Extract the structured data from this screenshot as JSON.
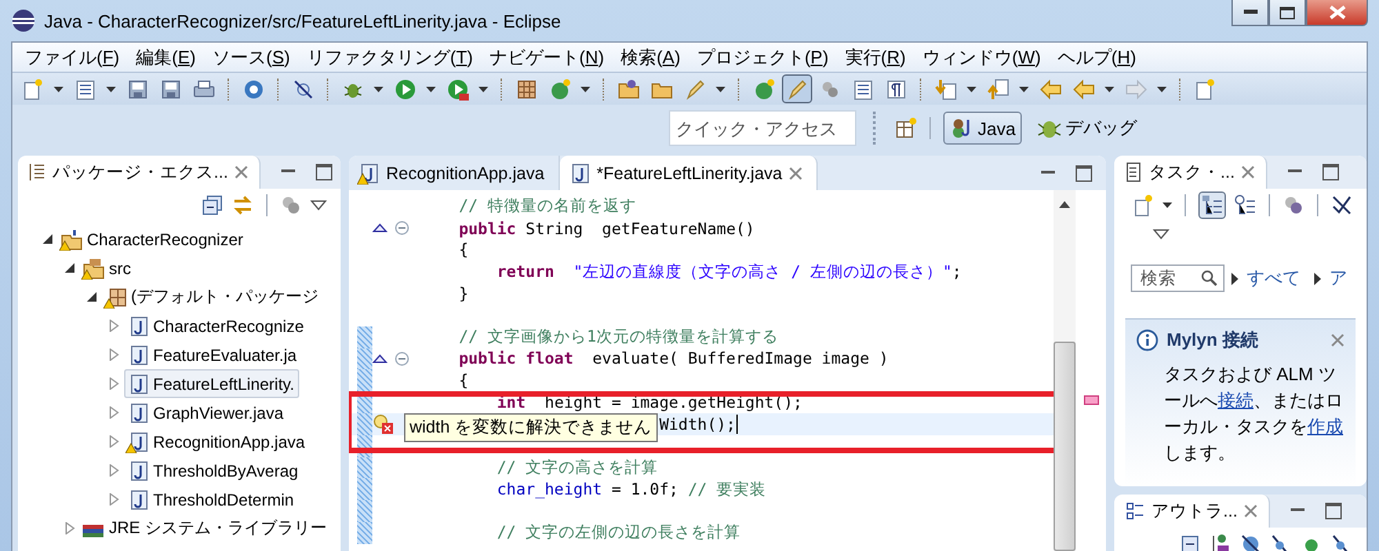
{
  "window": {
    "title": "Java - CharacterRecognizer/src/FeatureLeftLinerity.java - Eclipse"
  },
  "menu": [
    {
      "pre": "ファイル(",
      "key": "F",
      "post": ")"
    },
    {
      "pre": "編集(",
      "key": "E",
      "post": ")"
    },
    {
      "pre": "ソース(",
      "key": "S",
      "post": ")"
    },
    {
      "pre": "リファクタリング(",
      "key": "T",
      "post": ")"
    },
    {
      "pre": "ナビゲート(",
      "key": "N",
      "post": ")"
    },
    {
      "pre": "検索(",
      "key": "A",
      "post": ")"
    },
    {
      "pre": "プロジェクト(",
      "key": "P",
      "post": ")"
    },
    {
      "pre": "実行(",
      "key": "R",
      "post": ")"
    },
    {
      "pre": "ウィンドウ(",
      "key": "W",
      "post": ")"
    },
    {
      "pre": "ヘルプ(",
      "key": "H",
      "post": ")"
    }
  ],
  "quick_access": {
    "placeholder": "クイック・アクセス"
  },
  "perspectives": [
    {
      "label": "Java",
      "kind": "java",
      "selected": true
    },
    {
      "label": "デバッグ",
      "kind": "debug",
      "selected": false
    }
  ],
  "package_explorer": {
    "title": "パッケージ・エクス...",
    "tree": [
      {
        "label": "CharacterRecognizer",
        "kind": "project",
        "expanded": true,
        "selected": false,
        "warning": true,
        "children": [
          {
            "label": "src",
            "kind": "source-folder",
            "expanded": true,
            "selected": false,
            "warning": true,
            "children": [
              {
                "label": "(デフォルト・パッケージ",
                "kind": "package",
                "expanded": true,
                "selected": false,
                "warning": true,
                "children": [
                  {
                    "label": "CharacterRecognize",
                    "kind": "java-file",
                    "expanded": false,
                    "selected": false,
                    "warning": false
                  },
                  {
                    "label": "FeatureEvaluater.ja",
                    "kind": "java-file",
                    "expanded": false,
                    "selected": false,
                    "warning": false
                  },
                  {
                    "label": "FeatureLeftLinerity.",
                    "kind": "java-file",
                    "expanded": false,
                    "selected": true,
                    "warning": false
                  },
                  {
                    "label": "GraphViewer.java",
                    "kind": "java-file",
                    "expanded": false,
                    "selected": false,
                    "warning": false
                  },
                  {
                    "label": "RecognitionApp.java",
                    "kind": "java-file",
                    "expanded": false,
                    "selected": false,
                    "warning": true
                  },
                  {
                    "label": "ThresholdByAverag",
                    "kind": "java-file",
                    "expanded": false,
                    "selected": false,
                    "warning": false
                  },
                  {
                    "label": "ThresholdDetermin",
                    "kind": "java-file",
                    "expanded": false,
                    "selected": false,
                    "warning": false
                  }
                ]
              }
            ]
          },
          {
            "label": "JRE システム・ライブラリー",
            "kind": "library",
            "expanded": false,
            "selected": false,
            "warning": false
          }
        ]
      }
    ]
  },
  "editor": {
    "tabs": [
      {
        "label": "RecognitionApp.java",
        "selected": false,
        "warning": true
      },
      {
        "label": "*FeatureLeftLinerity.java",
        "selected": true,
        "warning": false
      }
    ],
    "lines": [
      {
        "override": false,
        "error": false,
        "fold": false,
        "changed": false,
        "current": false,
        "tokens": [
          {
            "kind": "comment",
            "text": "    // 特徴量の名前を返す"
          }
        ]
      },
      {
        "override": true,
        "error": false,
        "fold": true,
        "changed": false,
        "current": false,
        "tokens": [
          {
            "kind": "keyword",
            "text": "    public"
          },
          {
            "kind": "plain",
            "text": " String  getFeatureName()"
          }
        ]
      },
      {
        "override": false,
        "error": false,
        "fold": false,
        "changed": false,
        "current": false,
        "tokens": [
          {
            "kind": "plain",
            "text": "    {"
          }
        ]
      },
      {
        "override": false,
        "error": false,
        "fold": false,
        "changed": false,
        "current": false,
        "tokens": [
          {
            "kind": "keyword",
            "text": "        return"
          },
          {
            "kind": "string",
            "text": "  \"左辺の直線度（文字の高さ / 左側の辺の長さ）\""
          },
          {
            "kind": "plain",
            "text": ";"
          }
        ]
      },
      {
        "override": false,
        "error": false,
        "fold": false,
        "changed": false,
        "current": false,
        "tokens": [
          {
            "kind": "plain",
            "text": "    }"
          }
        ]
      },
      {
        "override": false,
        "error": false,
        "fold": false,
        "changed": false,
        "current": false
      },
      {
        "override": false,
        "error": false,
        "fold": false,
        "changed": true,
        "current": false,
        "tokens": [
          {
            "kind": "comment",
            "text": "    // 文字画像から1次元の特徴量を計算する"
          }
        ]
      },
      {
        "override": true,
        "error": false,
        "fold": true,
        "changed": true,
        "current": false,
        "tokens": [
          {
            "kind": "keyword",
            "text": "    public float"
          },
          {
            "kind": "plain",
            "text": "  evaluate( BufferedImage image )"
          }
        ]
      },
      {
        "override": false,
        "error": false,
        "fold": false,
        "changed": true,
        "current": false,
        "tokens": [
          {
            "kind": "plain",
            "text": "    {"
          }
        ]
      },
      {
        "override": false,
        "error": false,
        "fold": false,
        "changed": true,
        "current": false,
        "tokens": [
          {
            "kind": "keyword",
            "text": "        int"
          },
          {
            "kind": "plain",
            "text": "  height = image.getHeight();"
          }
        ]
      },
      {
        "override": false,
        "error": true,
        "fold": false,
        "changed": true,
        "current": true,
        "tokens": [
          {
            "kind": "plain",
            "text": "                         Width();"
          }
        ]
      },
      {
        "override": false,
        "error": false,
        "fold": false,
        "changed": true,
        "current": false
      },
      {
        "override": false,
        "error": false,
        "fold": false,
        "changed": true,
        "current": false,
        "tokens": [
          {
            "kind": "comment",
            "text": "        // 文字の高さを計算"
          }
        ]
      },
      {
        "override": false,
        "error": false,
        "fold": false,
        "changed": true,
        "current": false,
        "tokens": [
          {
            "kind": "field",
            "text": "        char_height"
          },
          {
            "kind": "plain",
            "text": " = 1.0f; "
          },
          {
            "kind": "comment",
            "text": "// 要実装"
          }
        ]
      },
      {
        "override": false,
        "error": false,
        "fold": false,
        "changed": true,
        "current": false
      },
      {
        "override": false,
        "error": false,
        "fold": false,
        "changed": true,
        "current": false,
        "tokens": [
          {
            "kind": "comment",
            "text": "        // 文字の左側の辺の長さを計算"
          }
        ]
      }
    ],
    "tooltip": "width を変数に解決できません"
  },
  "task_list": {
    "title": "タスク・...",
    "search": {
      "placeholder": "検索"
    },
    "filters": [
      "すべて",
      "ア"
    ]
  },
  "mylyn": {
    "title": "Mylyn 接続",
    "before": "タスクおよび ALM ツールへ",
    "link1": "接続",
    "middle": "、またはローカル・タスクを",
    "link2": "作成",
    "after": "します。"
  },
  "outline": {
    "title": "アウトラ..."
  }
}
